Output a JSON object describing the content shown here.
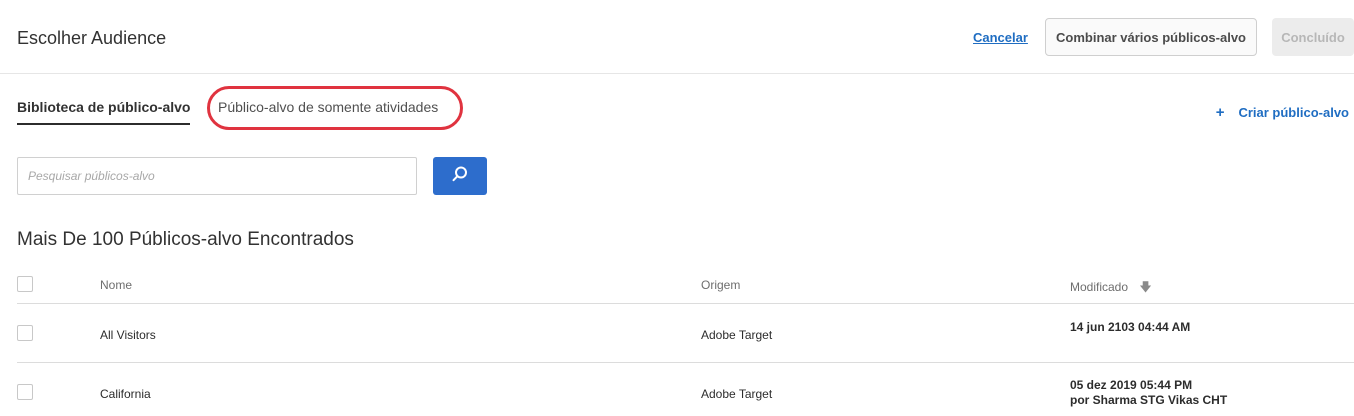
{
  "header": {
    "title": "Escolher Audience",
    "cancel_label": "Cancelar",
    "combine_label": "Combinar vários públicos-alvo",
    "done_label": "Concluído"
  },
  "tabs": [
    {
      "label": "Biblioteca de público-alvo",
      "active": true
    },
    {
      "label": "Público-alvo de somente atividades",
      "active": false
    }
  ],
  "create": {
    "icon": "plus-icon",
    "label": "Criar público-alvo"
  },
  "search": {
    "placeholder": "Pesquisar públicos-alvo",
    "value": "",
    "button_icon": "search-icon"
  },
  "results": {
    "count_label": "Mais De 100 Públicos-alvo Encontrados"
  },
  "table": {
    "columns": {
      "name": "Nome",
      "origin": "Origem",
      "modified": "Modificado"
    },
    "sort_icon": "arrow-down-icon",
    "rows": [
      {
        "name": "All Visitors",
        "origin": "Adobe Target",
        "modified": "14 jun 2103  04:44 AM",
        "modified_by": ""
      },
      {
        "name": "California",
        "origin": "Adobe Target",
        "modified": "05 dez 2019  05:44 PM",
        "modified_by": "por Sharma STG Vikas CHT"
      }
    ]
  },
  "colors": {
    "accent": "#2d6dcc",
    "link": "#1f6dc2",
    "highlight": "#e0333f"
  }
}
